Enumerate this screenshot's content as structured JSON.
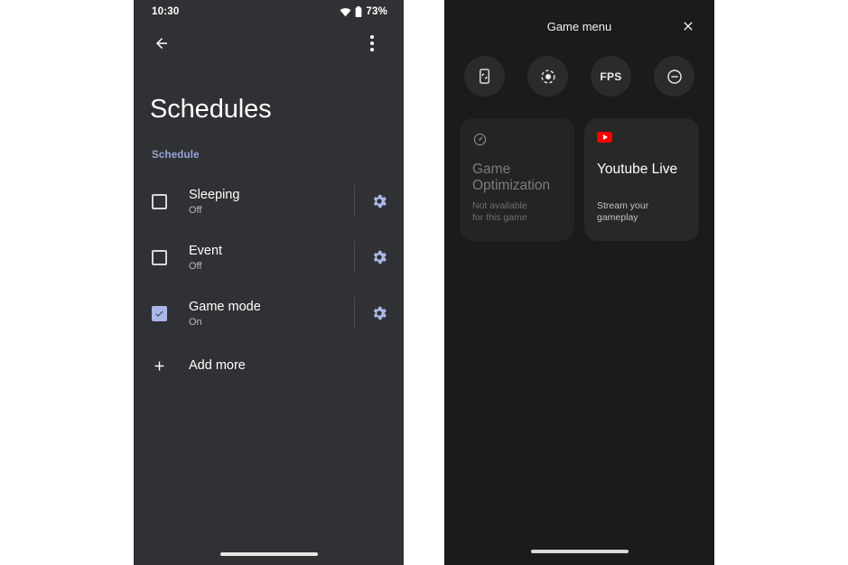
{
  "left_phone": {
    "status_bar": {
      "time": "10:30",
      "wifi_icon": "wifi-icon",
      "battery_icon": "battery-icon",
      "battery_text": "73%"
    },
    "app_bar": {
      "back_icon": "back-arrow-icon",
      "overflow_icon": "more-vert-icon"
    },
    "page_title": "Schedules",
    "section_label": "Schedule",
    "schedules": [
      {
        "title": "Sleeping",
        "status": "Off",
        "checked": false,
        "gear_icon": "gear-icon"
      },
      {
        "title": "Event",
        "status": "Off",
        "checked": false,
        "gear_icon": "gear-icon"
      },
      {
        "title": "Game mode",
        "status": "On",
        "checked": true,
        "gear_icon": "gear-icon"
      }
    ],
    "add_more": {
      "label": "Add more",
      "icon": "plus-icon"
    }
  },
  "right_phone": {
    "header": {
      "title": "Game menu",
      "close_icon": "close-icon"
    },
    "quick_actions": [
      {
        "name": "screenshot-button",
        "icon": "phone-screenshot-icon",
        "label": ""
      },
      {
        "name": "screen-record-button",
        "icon": "record-icon",
        "label": ""
      },
      {
        "name": "fps-button",
        "icon": "fps-text-icon",
        "label": "FPS"
      },
      {
        "name": "dnd-button",
        "icon": "do-not-disturb-icon",
        "label": ""
      }
    ],
    "cards": [
      {
        "title": "Game Optimization",
        "subtitle": "Not available\nfor this game",
        "subtitle_line1": "Not available",
        "subtitle_line2": "for this game",
        "icon": "speedometer-icon",
        "disabled": true
      },
      {
        "title": "Youtube Live",
        "subtitle": "Stream your gameplay",
        "icon": "youtube-icon",
        "disabled": false
      }
    ]
  },
  "colors": {
    "left_bg": "#303134",
    "right_bg": "#1b1b1b",
    "accent_blue": "#aab6e8",
    "section_blue": "#9aa3d8",
    "youtube_red": "#ff0000",
    "card_bg": "#282828"
  }
}
